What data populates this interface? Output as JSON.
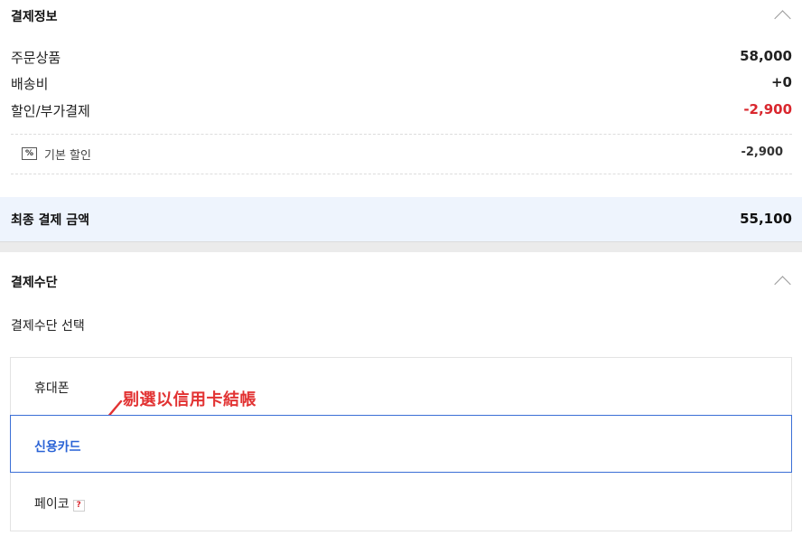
{
  "payment_info": {
    "title": "결제정보",
    "rows": [
      {
        "label": "주문상품",
        "value": "58,000"
      },
      {
        "label": "배송비",
        "value": "+0"
      },
      {
        "label": "할인/부가결제",
        "value": "-2,900"
      }
    ],
    "discount_detail": {
      "icon": "percent-icon",
      "icon_text": "%",
      "label": "기본 할인",
      "value": "-2,900"
    },
    "final": {
      "label": "최종 결제 금액",
      "value": "55,100"
    }
  },
  "payment_method": {
    "title": "결제수단",
    "select_label": "결제수단 선택",
    "options": [
      {
        "label": "휴대폰",
        "selected": false
      },
      {
        "label": "신용카드",
        "selected": true
      },
      {
        "label": "페이코",
        "selected": false,
        "help_icon": "?"
      }
    ]
  },
  "annotation": {
    "text": "剔選以信用卡結帳",
    "color": "#e23232"
  },
  "colors": {
    "accent_blue": "#2a63d6",
    "discount_red": "#d9272e",
    "final_bg": "#eef4fd"
  }
}
